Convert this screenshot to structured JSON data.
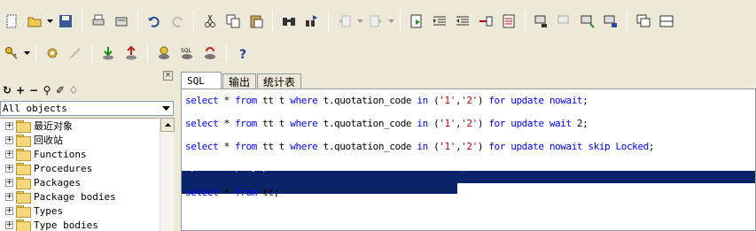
{
  "toolbar1": {
    "icons": [
      "new-icon",
      "open-icon",
      "save-icon",
      "print-icon",
      "print-preview-icon",
      "undo-icon",
      "redo-icon",
      "cut-icon",
      "copy-icon",
      "paste-icon",
      "find-icon",
      "find-next-icon",
      "go-back-icon",
      "go-forward-icon",
      "execute-icon",
      "indent-icon",
      "unindent-icon",
      "comment-icon",
      "uncomment-icon",
      "session-icon",
      "disconnect-icon",
      "log-on-icon",
      "window-list-icon",
      "tile-icon"
    ]
  },
  "toolbar2": {
    "icons": [
      "key-icon",
      "options-icon",
      "broken-icon",
      "import-icon",
      "export-icon",
      "db-icon",
      "sql-icon",
      "refresh-db-icon",
      "help-icon"
    ]
  },
  "left_panel": {
    "close_glyph": "×",
    "tools": [
      "↻",
      "+",
      "−",
      "⚲",
      "✐",
      "♢"
    ],
    "filter_value": "All objects",
    "tree_items": [
      {
        "expander": "+",
        "label": "最近对象"
      },
      {
        "expander": "+",
        "label": "回收站"
      },
      {
        "expander": "+",
        "label": "Functions"
      },
      {
        "expander": "+",
        "label": "Procedures"
      },
      {
        "expander": "+",
        "label": "Packages"
      },
      {
        "expander": "+",
        "label": "Package bodies"
      },
      {
        "expander": "+",
        "label": "Types"
      },
      {
        "expander": "+",
        "label": "Type bodies"
      }
    ]
  },
  "editor": {
    "tabs": [
      {
        "label": "SQL",
        "active": true
      },
      {
        "label": "输出",
        "active": false
      },
      {
        "label": "统计表",
        "active": false
      }
    ],
    "lines": [
      "select * from tt t where t.quotation_code in ('1','2') for update nowait;",
      "select * from tt t where t.quotation_code in ('1','2') for update wait 2;",
      "select * from tt t where t.quotation_code in ('1','2') for update nowait skip Locked;",
      "update deployop.tt t set t.a = 'X' where t.a = '1';",
      "select * from tt;"
    ]
  },
  "colors": {
    "toolbar_bg": "#ece9d8",
    "selection": "#0a246a",
    "keyword": "#0000ff",
    "string": "#c00000"
  }
}
